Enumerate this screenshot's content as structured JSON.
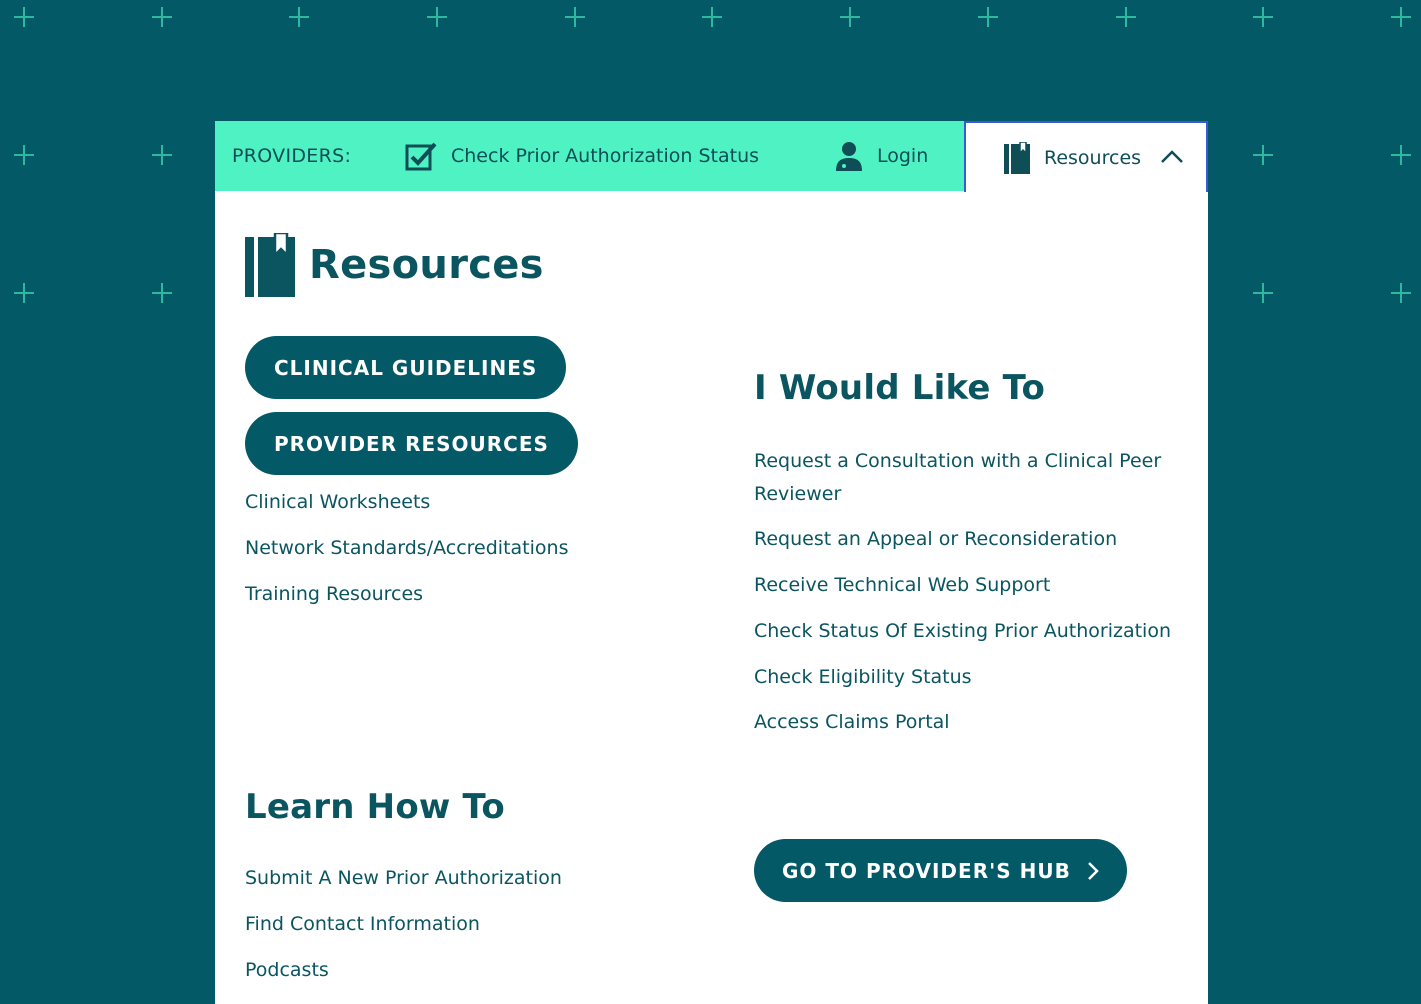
{
  "topbar": {
    "label": "PROVIDERS:",
    "check_status": "Check Prior Authorization Status",
    "login": "Login",
    "resources": "Resources"
  },
  "panel": {
    "title": "Resources",
    "buttons": [
      "CLINICAL GUIDELINES",
      "PROVIDER RESOURCES"
    ],
    "left_links": [
      "Clinical Worksheets",
      "Network Standards/Accreditations",
      "Training Resources"
    ],
    "would_like_heading": "I Would Like To",
    "would_like_links": [
      "Request a Consultation with a Clinical Peer Reviewer",
      "Request an Appeal or Reconsideration",
      "Receive Technical Web Support",
      "Check Status Of Existing Prior Authorization",
      "Check Eligibility Status",
      "Access Claims Portal"
    ],
    "learn_heading": "Learn How To",
    "learn_links": [
      "Submit A New Prior Authorization",
      "Find Contact Information",
      "Podcasts"
    ],
    "hub_button": "GO TO PROVIDER'S HUB"
  },
  "colors": {
    "background": "#035A66",
    "topbar": "#4FF2C2",
    "accent_text": "#0A5560",
    "pattern": "#2FB7A0",
    "tab_border": "#3B5BD6"
  },
  "icons": [
    "checkbox-check-icon",
    "doctor-icon",
    "book-icon",
    "chevron-up-icon",
    "chevron-right-icon"
  ]
}
